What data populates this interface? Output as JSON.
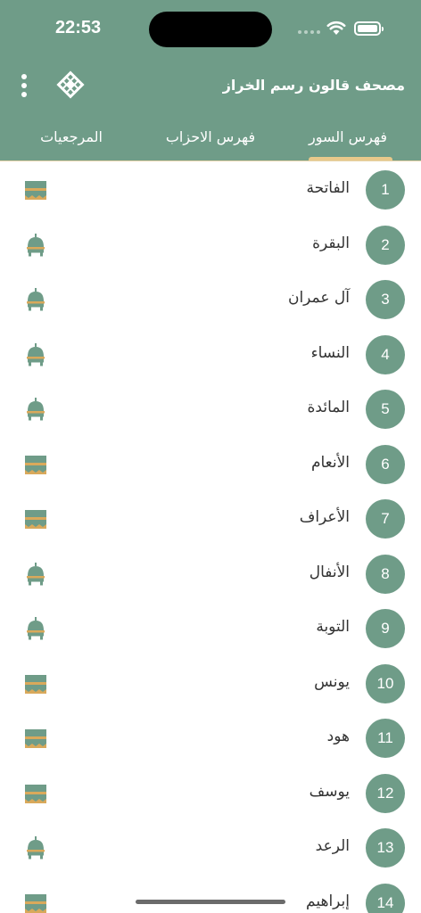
{
  "status_bar": {
    "time": "22:53"
  },
  "header": {
    "title": "مصحف قالون رسم الخراز"
  },
  "tabs": [
    {
      "label": "فهرس السور",
      "active": true
    },
    {
      "label": "فهرس الاحزاب",
      "active": false
    },
    {
      "label": "المرجعيات",
      "active": false
    }
  ],
  "colors": {
    "brand_green": "#6f9c88",
    "tab_indicator": "#e8c98b",
    "kaaba_gold": "#d9a95b"
  },
  "surahs": [
    {
      "number": "1",
      "name": "الفاتحة",
      "icon": "kaaba-icon"
    },
    {
      "number": "2",
      "name": "البقرة",
      "icon": "mosque-icon"
    },
    {
      "number": "3",
      "name": "آل عمران",
      "icon": "mosque-icon"
    },
    {
      "number": "4",
      "name": "النساء",
      "icon": "mosque-icon"
    },
    {
      "number": "5",
      "name": "المائدة",
      "icon": "mosque-icon"
    },
    {
      "number": "6",
      "name": "الأنعام",
      "icon": "kaaba-icon"
    },
    {
      "number": "7",
      "name": "الأعراف",
      "icon": "kaaba-icon"
    },
    {
      "number": "8",
      "name": "الأنفال",
      "icon": "mosque-icon"
    },
    {
      "number": "9",
      "name": "التوبة",
      "icon": "mosque-icon"
    },
    {
      "number": "10",
      "name": "يونس",
      "icon": "kaaba-icon"
    },
    {
      "number": "11",
      "name": "هود",
      "icon": "kaaba-icon"
    },
    {
      "number": "12",
      "name": "يوسف",
      "icon": "kaaba-icon"
    },
    {
      "number": "13",
      "name": "الرعد",
      "icon": "mosque-icon"
    },
    {
      "number": "14",
      "name": "إبراهيم",
      "icon": "kaaba-icon"
    }
  ]
}
